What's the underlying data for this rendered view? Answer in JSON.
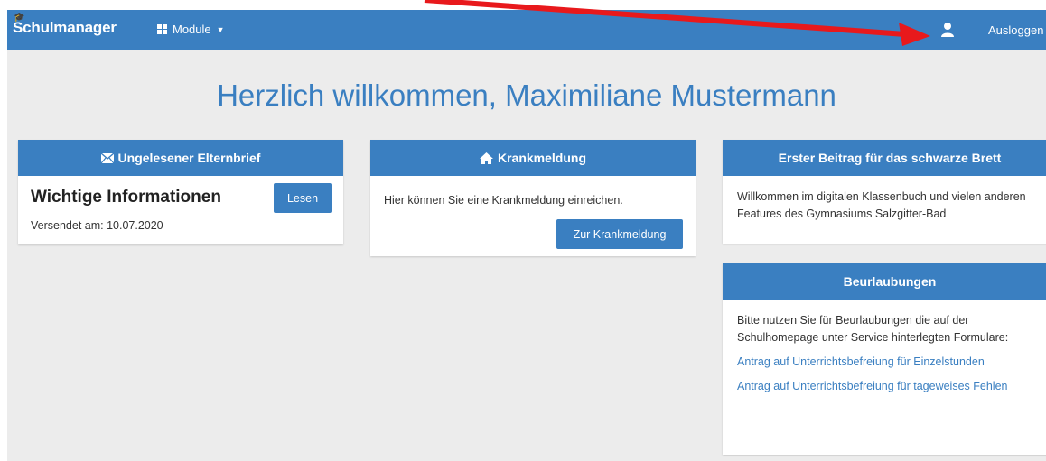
{
  "navbar": {
    "brand": "Schulmanager",
    "module_label": "Module",
    "logout_label": "Ausloggen"
  },
  "page_title": "Herzlich willkommen, Maximiliane Mustermann",
  "cards": {
    "letter": {
      "header": "Ungelesener Elternbrief",
      "title": "Wichtige Informationen",
      "sent": "Versendet am: 10.07.2020",
      "button": "Lesen"
    },
    "sick": {
      "header": "Krankmeldung",
      "text": "Hier können Sie eine Krankmeldung einreichen.",
      "button": "Zur Krankmeldung"
    },
    "board": {
      "header": "Erster Beitrag für das schwarze Brett",
      "text": "Willkommen im digitalen Klassenbuch und vielen anderen Features  des Gymnasiums Salzgitter-Bad"
    },
    "leave": {
      "header": "Beurlaubungen",
      "text": "Bitte nutzen Sie für Beurlaubungen die auf der Schulhomepage unter Service hinterlegten Formulare:",
      "link1": "Antrag auf Unterrichtsbefreiung für Einzelstunden",
      "link2": "Antrag auf Unterrichtsbefreiung für tageweises Fehlen"
    }
  },
  "colors": {
    "primary": "#3a7fc1",
    "background": "#ececec",
    "arrow": "#e8191c"
  },
  "icons": [
    "grid-icon",
    "user-icon",
    "envelope-icon",
    "home-icon",
    "arrow-annotation"
  ]
}
